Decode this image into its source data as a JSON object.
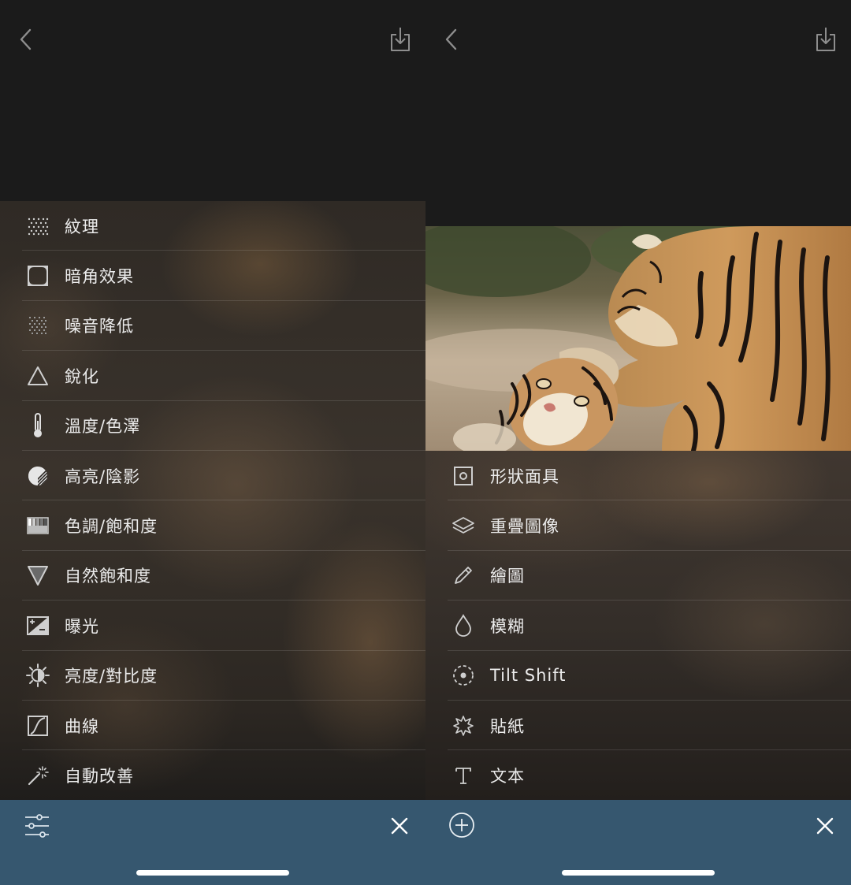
{
  "left_screen": {
    "icons": {
      "back": "chevron-left-icon",
      "share": "share-icon",
      "tools": "sliders-icon",
      "close": "close-icon"
    },
    "menu": [
      {
        "label": "紋理",
        "icon": "texture-icon"
      },
      {
        "label": "暗角效果",
        "icon": "vignette-icon"
      },
      {
        "label": "噪音降低",
        "icon": "noise-reduction-icon"
      },
      {
        "label": "銳化",
        "icon": "sharpen-icon"
      },
      {
        "label": "溫度/色澤",
        "icon": "thermometer-icon"
      },
      {
        "label": "高亮/陰影",
        "icon": "highlights-shadows-icon"
      },
      {
        "label": "色調/飽和度",
        "icon": "hue-saturation-icon"
      },
      {
        "label": "自然飽和度",
        "icon": "vibrance-icon"
      },
      {
        "label": "曝光",
        "icon": "exposure-icon"
      },
      {
        "label": "亮度/對比度",
        "icon": "brightness-contrast-icon"
      },
      {
        "label": "曲線",
        "icon": "curves-icon"
      },
      {
        "label": "自動改善",
        "icon": "magic-wand-icon"
      }
    ]
  },
  "right_screen": {
    "icons": {
      "back": "chevron-left-icon",
      "share": "share-icon",
      "add": "plus-circle-icon",
      "close": "close-icon"
    },
    "menu": [
      {
        "label": "形狀面具",
        "icon": "shape-mask-icon"
      },
      {
        "label": "重疊圖像",
        "icon": "layers-icon"
      },
      {
        "label": "繪圖",
        "icon": "pencil-icon"
      },
      {
        "label": "模糊",
        "icon": "droplet-icon"
      },
      {
        "label": "Tilt Shift",
        "icon": "tilt-shift-icon"
      },
      {
        "label": "貼紙",
        "icon": "sticker-icon"
      },
      {
        "label": "文本",
        "icon": "text-icon"
      }
    ]
  },
  "colors": {
    "background": "#1b1b1b",
    "bottom_bar": "#36576f",
    "text": "#ececec"
  }
}
